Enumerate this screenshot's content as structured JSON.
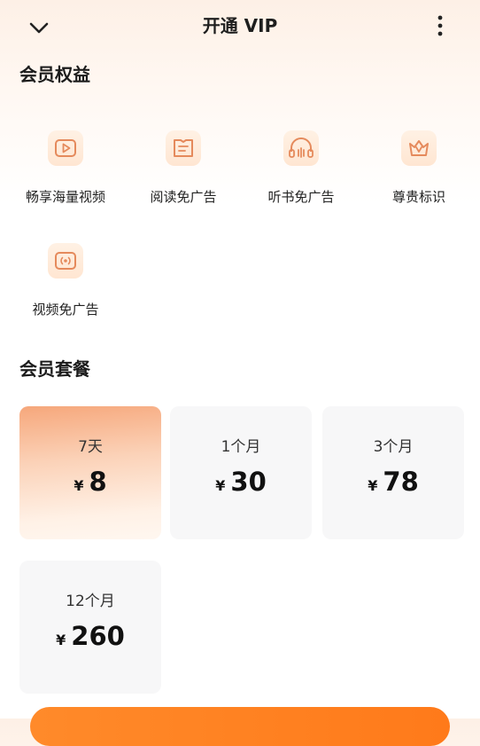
{
  "header": {
    "title": "开通 VIP"
  },
  "benefits": {
    "section_title": "会员权益",
    "items": [
      {
        "label": "畅享海量视频",
        "icon": "video-play-icon"
      },
      {
        "label": "阅读免广告",
        "icon": "book-icon"
      },
      {
        "label": "听书免广告",
        "icon": "headphones-icon"
      },
      {
        "label": "尊贵标识",
        "icon": "crown-icon"
      },
      {
        "label": "视频免广告",
        "icon": "video-broadcast-icon"
      }
    ]
  },
  "plans": {
    "section_title": "会员套餐",
    "currency": "¥",
    "items": [
      {
        "duration": "7天",
        "price": "8",
        "selected": true
      },
      {
        "duration": "1个月",
        "price": "30",
        "selected": false
      },
      {
        "duration": "3个月",
        "price": "78",
        "selected": false
      },
      {
        "duration": "12个月",
        "price": "260",
        "selected": false
      }
    ]
  },
  "colors": {
    "accent": "#ff8a2a",
    "icon_stroke": "#e58a5c",
    "selected_card_top": "#f6a77b"
  }
}
